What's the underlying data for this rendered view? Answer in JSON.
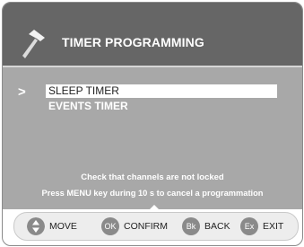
{
  "header": {
    "title": "TIMER PROGRAMMING",
    "icon": "hammer-icon"
  },
  "menu": {
    "pointer": ">",
    "items": [
      {
        "label": "SLEEP TIMER",
        "selected": true
      },
      {
        "label": "EVENTS TIMER",
        "selected": false
      }
    ]
  },
  "notices": {
    "line1": "Check that channels are not locked",
    "line2": "Press MENU key during 10 s to cancel a programmation"
  },
  "nav": {
    "move": {
      "key": "",
      "icon": "up-down-arrows-icon",
      "label": "MOVE"
    },
    "confirm": {
      "key": "OK",
      "label": "CONFIRM"
    },
    "back": {
      "key": "Bk",
      "label": "BACK"
    },
    "exit": {
      "key": "Ex",
      "label": "EXIT"
    }
  },
  "colors": {
    "header_bg": "#666666",
    "screen_bg": "#a8a8a8",
    "key_circle": "#8a8a8a",
    "nav_bg": "#ededed"
  }
}
